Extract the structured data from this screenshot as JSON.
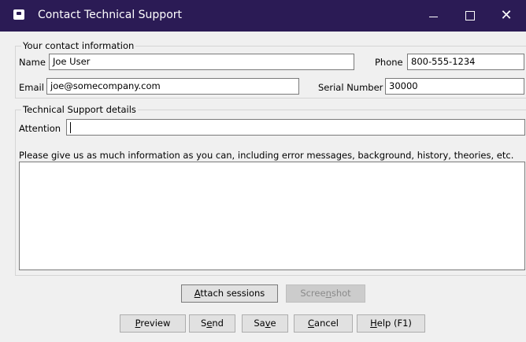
{
  "window": {
    "title": "Contact Technical Support",
    "minimize": "–",
    "maximize": "□",
    "close": "✕",
    "icon": "app-window-icon"
  },
  "contact": {
    "legend": "Your contact information",
    "name_label": "Name",
    "name_value": "Joe User",
    "phone_label": "Phone",
    "phone_value": "800-555-1234",
    "email_label": "Email",
    "email_value": "joe@somecompany.com",
    "serial_label": "Serial Number",
    "serial_value": "30000"
  },
  "support": {
    "legend": "Technical Support details",
    "attention_label": "Attention",
    "attention_value": "",
    "instructions": "Please give us as much information as you can, including error messages, background, history, theories, etc.",
    "details_value": ""
  },
  "buttons": {
    "attach": {
      "pre": "",
      "key": "A",
      "post": "ttach sessions"
    },
    "screenshot": {
      "pre": "Scree",
      "key": "n",
      "post": "shot"
    },
    "preview": {
      "pre": "",
      "key": "P",
      "post": "review"
    },
    "send": {
      "pre": "S",
      "key": "e",
      "post": "nd"
    },
    "save": {
      "pre": "Sa",
      "key": "v",
      "post": "e"
    },
    "cancel": {
      "pre": "",
      "key": "C",
      "post": "ancel"
    },
    "help": {
      "pre": "",
      "key": "H",
      "post": "elp (F1)"
    }
  }
}
